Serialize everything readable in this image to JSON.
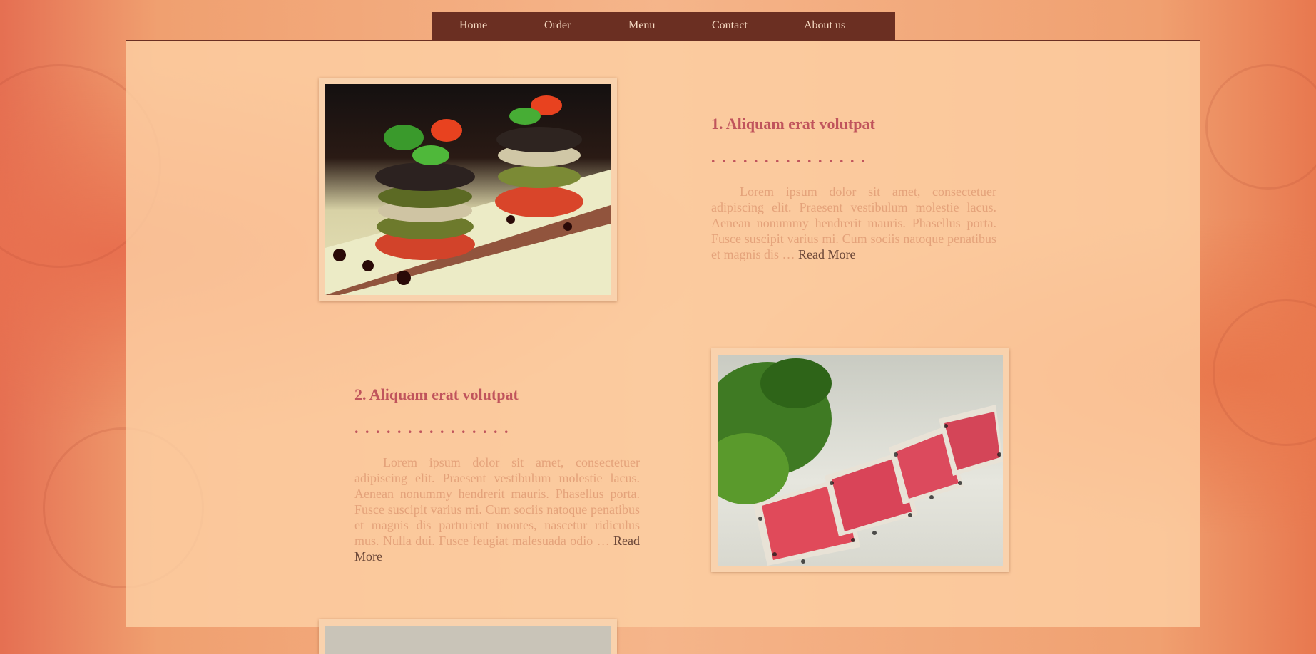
{
  "nav": {
    "items": [
      "Home",
      "Order",
      "Menu",
      "Contact",
      "About us"
    ]
  },
  "articles": [
    {
      "title": "1. Aliquam erat volutpat",
      "dots": ". . . . . . . . . . . . . . .",
      "text": "Lorem ipsum dolor sit amet, consectetuer adipiscing elit. Praesent vestibulum molestie lacus. Aenean nonummy hendrerit mauris. Phasellus porta. Fusce suscipit varius mi. Cum sociis natoque penatibus et magnis dis …",
      "read_more": "Read More",
      "image": "food-photo-vegetable-stacks"
    },
    {
      "title": "2. Aliquam erat volutpat",
      "dots": ". . . . . . . . . . . . . . .",
      "text": "Lorem ipsum dolor sit amet, consectetuer adipiscing elit. Praesent vestibulum molestie lacus. Aenean nonummy hendrerit mauris. Phasellus porta. Fusce suscipit varius mi. Cum sociis natoque penatibus et magnis dis parturient montes, nascetur ridiculus mus. Nulla dui. Fusce feugiat malesuada odio …",
      "read_more": "Read More",
      "image": "food-photo-seared-tuna"
    }
  ],
  "colors": {
    "nav_bg": "#6b2f22",
    "title": "#c0545c",
    "body_text": "#e4a27a",
    "link": "#6a4637"
  }
}
